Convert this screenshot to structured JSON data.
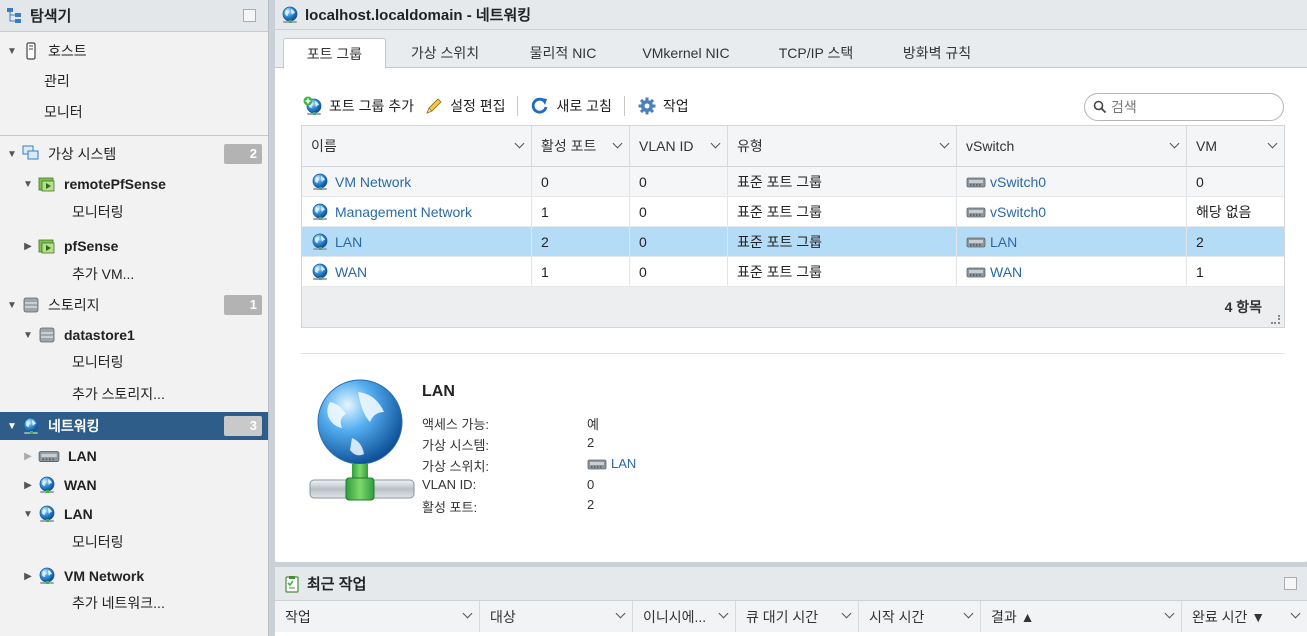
{
  "navigator": {
    "title": "탐색기",
    "items": [
      {
        "label": "호스트"
      },
      {
        "label": "관리"
      },
      {
        "label": "모니터"
      },
      {
        "label": "가상 시스템",
        "badge": "2"
      },
      {
        "label": "remotePfSense"
      },
      {
        "label": "모니터링"
      },
      {
        "label": "pfSense"
      },
      {
        "label": "추가 VM..."
      },
      {
        "label": "스토리지",
        "badge": "1"
      },
      {
        "label": "datastore1"
      },
      {
        "label": "모니터링"
      },
      {
        "label": "추가 스토리지..."
      },
      {
        "label": "네트워킹",
        "badge": "3"
      },
      {
        "label": "LAN"
      },
      {
        "label": "WAN"
      },
      {
        "label": "LAN"
      },
      {
        "label": "모니터링"
      },
      {
        "label": "VM Network"
      },
      {
        "label": "추가 네트워크..."
      }
    ]
  },
  "window": {
    "title": "localhost.localdomain - 네트워킹"
  },
  "tabs": [
    {
      "label": "포트 그룹"
    },
    {
      "label": "가상 스위치"
    },
    {
      "label": "물리적 NIC"
    },
    {
      "label": "VMkernel NIC"
    },
    {
      "label": "TCP/IP 스택"
    },
    {
      "label": "방화벽 규칙"
    }
  ],
  "toolbar": {
    "add_label": "포트 그룹 추가",
    "edit_label": "설정 편집",
    "refresh_label": "새로 고침",
    "actions_label": "작업",
    "search_placeholder": "검색"
  },
  "grid": {
    "columns": [
      "이름",
      "활성 포트",
      "VLAN ID",
      "유형",
      "vSwitch",
      "VM"
    ],
    "rows": [
      {
        "name": "VM Network",
        "ports": "0",
        "vlan": "0",
        "type": "표준 포트 그룹",
        "vswitch": "vSwitch0",
        "vm": "0"
      },
      {
        "name": "Management Network",
        "ports": "1",
        "vlan": "0",
        "type": "표준 포트 그룹",
        "vswitch": "vSwitch0",
        "vm": "해당 없음"
      },
      {
        "name": "LAN",
        "ports": "2",
        "vlan": "0",
        "type": "표준 포트 그룹",
        "vswitch": "LAN",
        "vm": "2"
      },
      {
        "name": "WAN",
        "ports": "1",
        "vlan": "0",
        "type": "표준 포트 그룹",
        "vswitch": "WAN",
        "vm": "1"
      }
    ],
    "footer": "4 항목"
  },
  "detail": {
    "title": "LAN",
    "fields": [
      {
        "key": "액세스 가능:",
        "value": "예"
      },
      {
        "key": "가상 시스템:",
        "value": "2"
      },
      {
        "key": "가상 스위치:",
        "value": "LAN"
      },
      {
        "key": "VLAN ID:",
        "value": "0"
      },
      {
        "key": "활성 포트:",
        "value": "2"
      }
    ]
  },
  "recent_tasks": {
    "title": "최근 작업",
    "columns": [
      "작업",
      "대상",
      "이니시에...",
      "큐 대기 시간",
      "시작 시간",
      "결과 ▲",
      "완료 시간 ▼"
    ]
  }
}
